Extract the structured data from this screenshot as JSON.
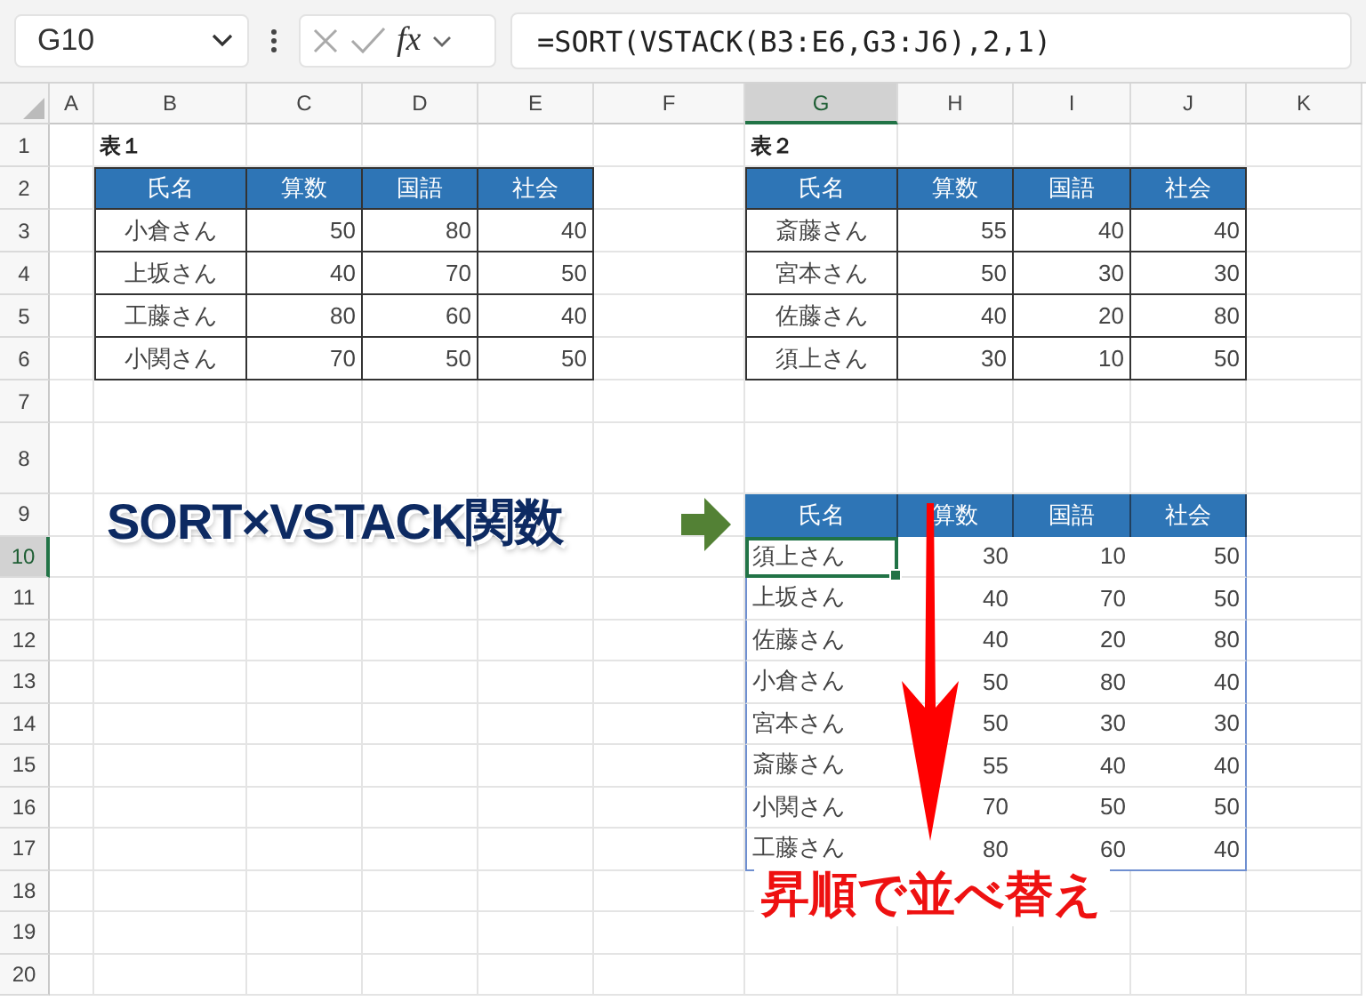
{
  "formula_bar": {
    "name_box": "G10",
    "fx": "fx",
    "formula": "=SORT(VSTACK(B3:E6,G3:J6),2,1)"
  },
  "columns": [
    {
      "label": "A",
      "selected": false
    },
    {
      "label": "B",
      "selected": false
    },
    {
      "label": "C",
      "selected": false
    },
    {
      "label": "D",
      "selected": false
    },
    {
      "label": "E",
      "selected": false
    },
    {
      "label": "F",
      "selected": false
    },
    {
      "label": "G",
      "selected": true
    },
    {
      "label": "H",
      "selected": false
    },
    {
      "label": "I",
      "selected": false
    },
    {
      "label": "J",
      "selected": false
    },
    {
      "label": "K",
      "selected": false
    }
  ],
  "rows": [
    {
      "label": "1",
      "selected": false
    },
    {
      "label": "2",
      "selected": false
    },
    {
      "label": "3",
      "selected": false
    },
    {
      "label": "4",
      "selected": false
    },
    {
      "label": "5",
      "selected": false
    },
    {
      "label": "6",
      "selected": false
    },
    {
      "label": "7",
      "selected": false
    },
    {
      "label": "8",
      "selected": false
    },
    {
      "label": "9",
      "selected": false
    },
    {
      "label": "10",
      "selected": true
    },
    {
      "label": "11",
      "selected": false
    },
    {
      "label": "12",
      "selected": false
    },
    {
      "label": "13",
      "selected": false
    },
    {
      "label": "14",
      "selected": false
    },
    {
      "label": "15",
      "selected": false
    },
    {
      "label": "16",
      "selected": false
    },
    {
      "label": "17",
      "selected": false
    },
    {
      "label": "18",
      "selected": false
    },
    {
      "label": "19",
      "selected": false
    },
    {
      "label": "20",
      "selected": false
    }
  ],
  "tables": [
    {
      "kind": "formatted",
      "title": "表１",
      "header": [
        "氏名",
        "算数",
        "国語",
        "社会"
      ],
      "rows": [
        [
          "小倉さん",
          "50",
          "80",
          "40"
        ],
        [
          "上坂さん",
          "40",
          "70",
          "50"
        ],
        [
          "工藤さん",
          "80",
          "60",
          "40"
        ],
        [
          "小関さん",
          "70",
          "50",
          "50"
        ]
      ]
    },
    {
      "kind": "formatted",
      "title": "表２",
      "header": [
        "氏名",
        "算数",
        "国語",
        "社会"
      ],
      "rows": [
        [
          "斎藤さん",
          "55",
          "40",
          "40"
        ],
        [
          "宮本さん",
          "50",
          "30",
          "30"
        ],
        [
          "佐藤さん",
          "40",
          "20",
          "80"
        ],
        [
          "須上さん",
          "30",
          "10",
          "50"
        ]
      ]
    },
    {
      "kind": "spill",
      "header": [
        "氏名",
        "算数",
        "国語",
        "社会"
      ],
      "rows": [
        [
          "須上さん",
          "30",
          "10",
          "50"
        ],
        [
          "上坂さん",
          "40",
          "70",
          "50"
        ],
        [
          "佐藤さん",
          "40",
          "20",
          "80"
        ],
        [
          "小倉さん",
          "50",
          "80",
          "40"
        ],
        [
          "宮本さん",
          "50",
          "30",
          "30"
        ],
        [
          "斎藤さん",
          "55",
          "40",
          "40"
        ],
        [
          "小関さん",
          "70",
          "50",
          "50"
        ],
        [
          "工藤さん",
          "80",
          "60",
          "40"
        ]
      ]
    }
  ],
  "annotations": {
    "title": "SORT×VSTACK関数",
    "caption": "昇順で並べ替え"
  }
}
